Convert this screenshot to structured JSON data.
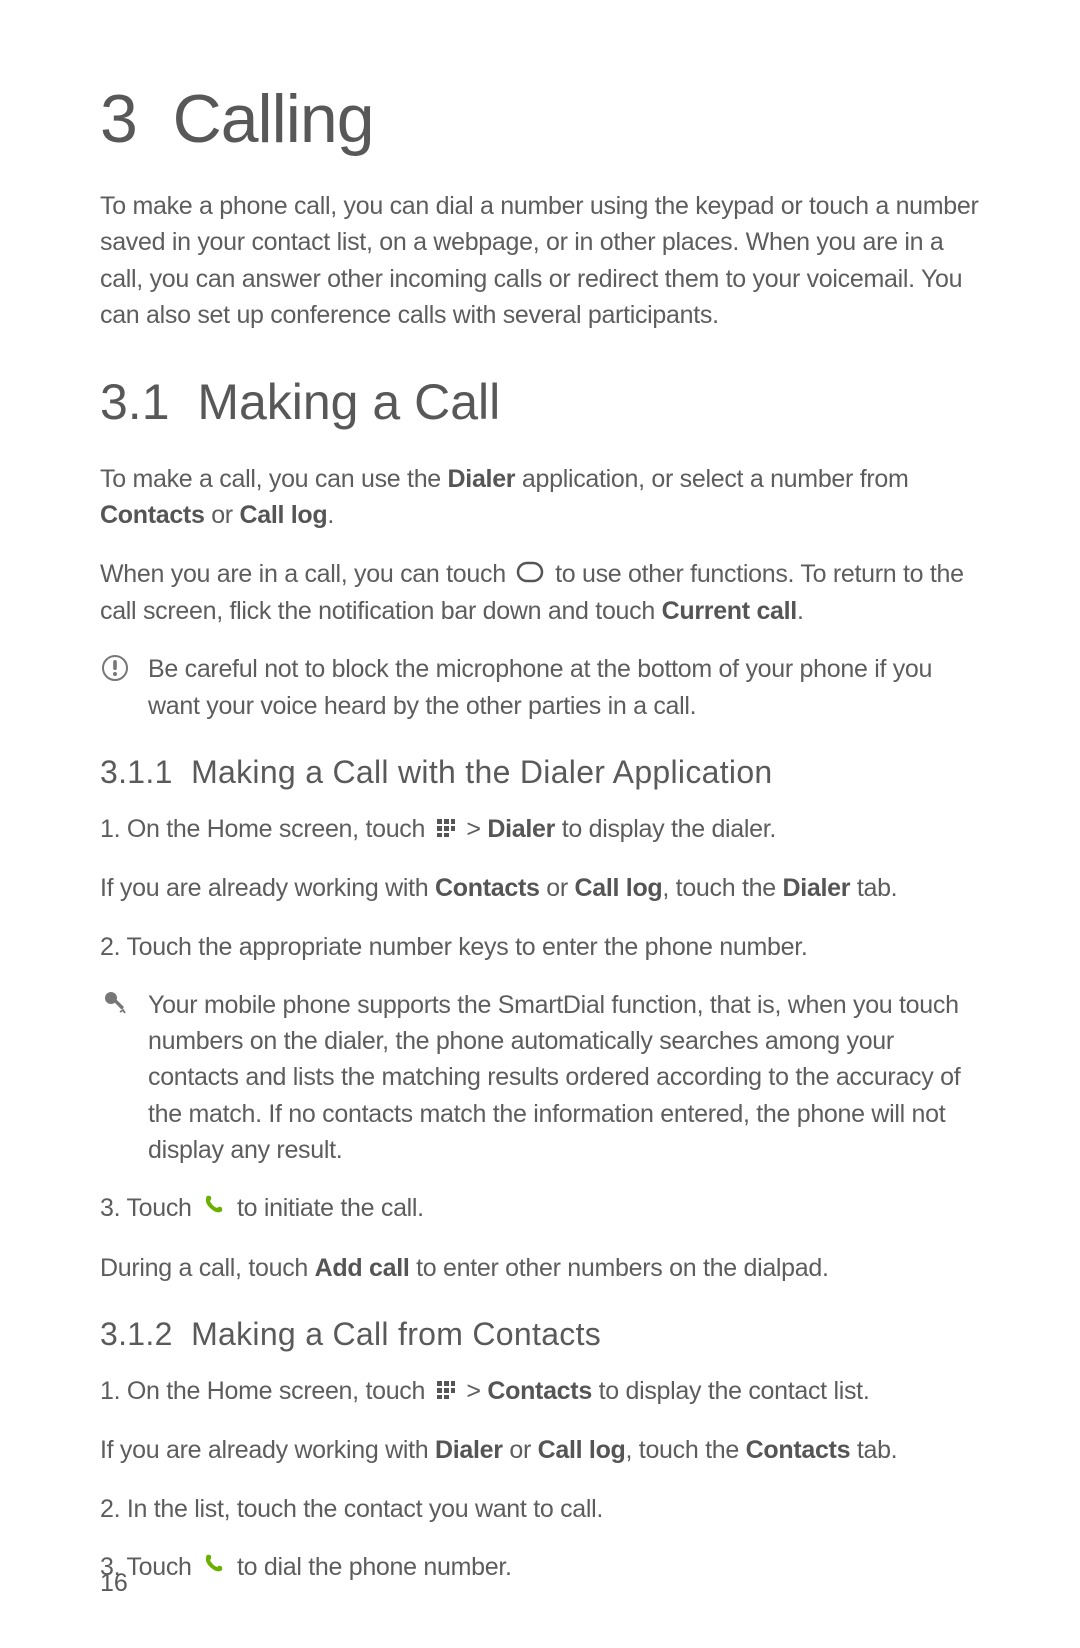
{
  "chapter": {
    "number": "3",
    "title": "Calling"
  },
  "intro": "To make a phone call, you can dial a number using the keypad or touch a number saved in your contact list, on a webpage, or in other places. When you are in a call, you can answer other incoming calls or redirect them to your voicemail. You can also set up conference calls with several participants.",
  "section_3_1": {
    "number": "3.1",
    "title": "Making a Call"
  },
  "p_3_1_a": {
    "pre": "To make a call, you can use the ",
    "b1": "Dialer",
    "mid": " application, or select a number from ",
    "b2": "Contacts",
    "mid2": " or ",
    "b3": "Call log",
    "post": "."
  },
  "p_3_1_b": {
    "pre": "When you are in a call, you can touch ",
    "mid": " to use other functions. To return to the call screen, flick the notification bar down and touch ",
    "b1": "Current call",
    "post": "."
  },
  "note_3_1": "Be careful not to block the microphone at the bottom of your phone if you want your voice heard by the other parties in a call.",
  "sub_3_1_1": {
    "number": "3.1.1",
    "title": "Making a Call with the Dialer Application"
  },
  "step_3_1_1_1": {
    "pre": "1. On the Home screen, touch ",
    "mid": "  > ",
    "b1": "Dialer",
    "post": " to display the dialer."
  },
  "step_3_1_1_1_sub": {
    "pre": "If you are already working with ",
    "b1": "Contacts",
    "mid": " or ",
    "b2": "Call log",
    "mid2": ", touch the ",
    "b3": "Dialer",
    "post": " tab."
  },
  "step_3_1_1_2": "2. Touch the appropriate number keys to enter the phone number.",
  "tip_3_1_1": "Your mobile phone supports the SmartDial function, that is, when you touch numbers on the dialer, the phone automatically searches among your contacts and lists the matching results ordered according to the accuracy of the match. If no contacts match the information entered, the phone will not display any result.",
  "step_3_1_1_3": {
    "pre": "3. Touch ",
    "post": " to initiate the call."
  },
  "step_3_1_1_3_sub": {
    "pre": "During a call, touch ",
    "b1": "Add call",
    "post": " to enter other numbers on the dialpad."
  },
  "sub_3_1_2": {
    "number": "3.1.2",
    "title": "Making a Call from Contacts"
  },
  "step_3_1_2_1": {
    "pre": "1. On the Home screen, touch ",
    "mid": "  > ",
    "b1": "Contacts",
    "post": " to display the contact list."
  },
  "step_3_1_2_1_sub": {
    "pre": "If you are already working with ",
    "b1": "Dialer",
    "mid": " or ",
    "b2": "Call log",
    "mid2": ", touch the ",
    "b3": "Contacts",
    "post": " tab."
  },
  "step_3_1_2_2": "2. In the list, touch the contact you want to call.",
  "step_3_1_2_3": {
    "pre": "3. Touch ",
    "post": " to dial the phone number."
  },
  "page_number": "16"
}
